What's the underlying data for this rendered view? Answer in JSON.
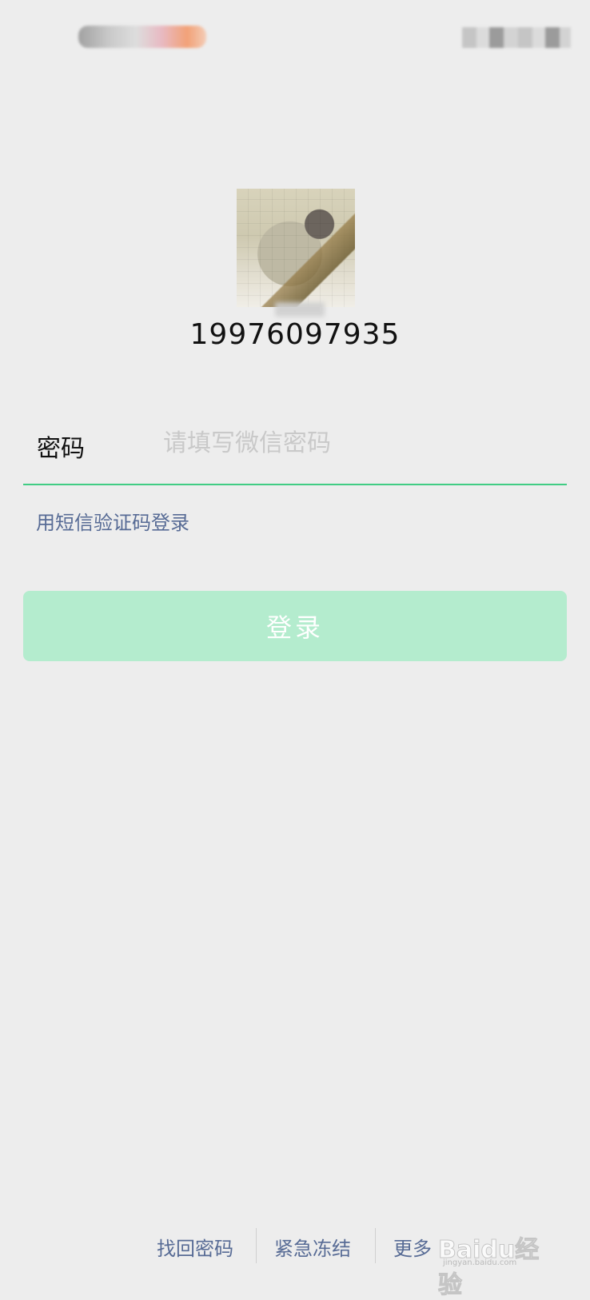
{
  "account": {
    "phone": "19976097935"
  },
  "login_form": {
    "password_label": "密码",
    "password_placeholder": "请填写微信密码",
    "sms_login_link": "用短信验证码登录",
    "login_button": "登录"
  },
  "bottom_links": {
    "find_password": "找回密码",
    "emergency_freeze": "紧急冻结",
    "more": "更多"
  },
  "watermark": {
    "text": "Baidu经验",
    "url_text": "jingyan.baidu.com"
  },
  "colors": {
    "background": "#ededed",
    "accent_green": "#07c160",
    "disabled_button": "#b4ecce",
    "link_blue": "#576b95",
    "placeholder": "#c9c9c9"
  },
  "icons": {
    "avatar": "avatar-photo"
  }
}
